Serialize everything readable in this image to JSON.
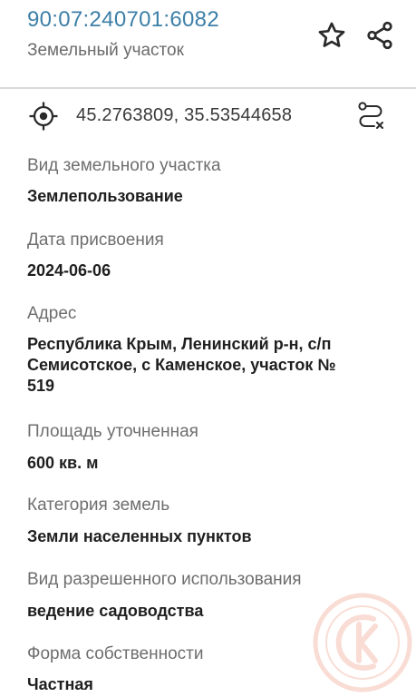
{
  "header": {
    "cadastral_number": "90:07:240701:6082",
    "object_type": "Земельный участок"
  },
  "location": {
    "coordinates": "45.2763809, 35.53544658"
  },
  "fields": [
    {
      "label": "Вид земельного участка",
      "value": "Землепользование"
    },
    {
      "label": "Дата присвоения",
      "value": "2024-06-06"
    },
    {
      "label": "Адрес",
      "value_lines": [
        "Республика Крым, Ленинский р-н, с/п",
        "Семисотское, с Каменское, участок №",
        "519"
      ]
    },
    {
      "label": "Площадь уточненная",
      "value": "600 кв. м"
    },
    {
      "label": "Категория земель",
      "value": "Земли населенных пунктов"
    },
    {
      "label": "Вид разрешенного использования",
      "value": "ведение садоводства"
    },
    {
      "label": "Форма собственности",
      "value": "Частная"
    }
  ],
  "icons": {
    "favorite": "star-icon",
    "share": "share-icon",
    "locate": "crosshair-icon",
    "route": "route-icon",
    "watermark": "logo-watermark"
  },
  "colors": {
    "accent": "#3d7fa8",
    "watermark": "#f0a088"
  }
}
